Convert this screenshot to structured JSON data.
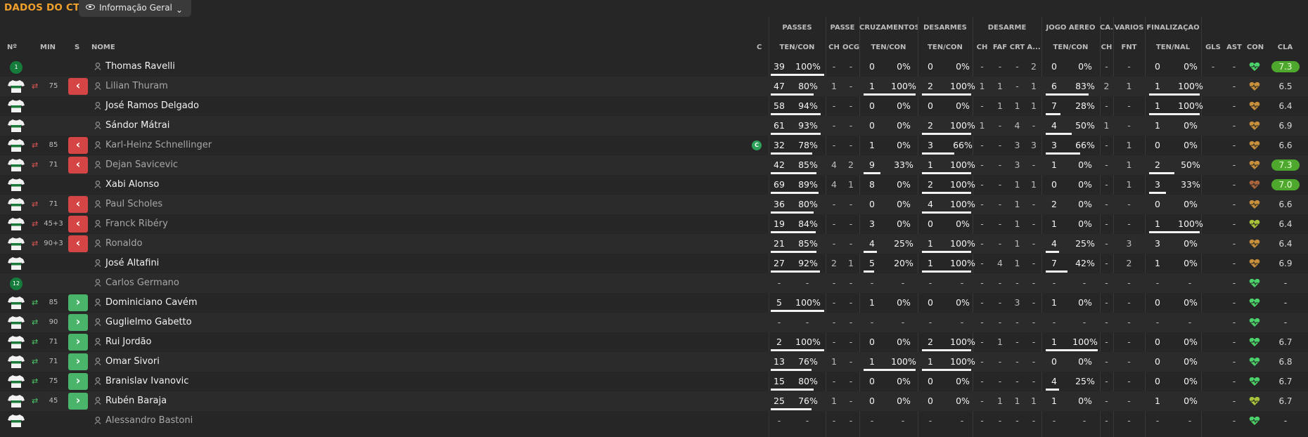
{
  "header": {
    "title": "DADOS DO CTB",
    "view_label": "Informação Geral",
    "view_icon": "eye-icon",
    "dropdown_icon": "chevron-down-icon"
  },
  "column_groups": [
    {
      "key": "passes",
      "label": "PASSES"
    },
    {
      "key": "passe",
      "label": "PASSE"
    },
    {
      "key": "cruzamentos",
      "label": "CRUZAMENTOS"
    },
    {
      "key": "desarmes",
      "label": "DESARMES"
    },
    {
      "key": "desarme",
      "label": "DESARME"
    },
    {
      "key": "jogo_aereo",
      "label": "JOGO AÉREO"
    },
    {
      "key": "ca",
      "label": "CA..."
    },
    {
      "key": "varios",
      "label": "VÁRIOS"
    },
    {
      "key": "finalizacao",
      "label": "FINALIZAÇÃO"
    }
  ],
  "columns": {
    "num": "Nº",
    "min": "MIN",
    "s": "S",
    "nome": "NOME",
    "c": "C",
    "passes": "TEN/CON",
    "passe_ch": "CH",
    "passe_ocg": "OCG",
    "cruz": "TEN/CON",
    "desarmes": "TEN/CON",
    "desarme_ch": "CH",
    "desarme_faf": "FAF",
    "desarme_crt": "CRT",
    "desarme_a": "A...",
    "aereo": "TEN/CON",
    "ca_ch": "CH",
    "varios_fnt": "FNT",
    "final": "TEN/NAL",
    "gls": "GLS",
    "ast": "AST",
    "con": "CON",
    "cla": "CLA"
  },
  "players": [
    {
      "num": "1",
      "kit": "goalkeeper",
      "min": "",
      "sub": "",
      "name": "Thomas Ravelli",
      "active": true,
      "captain": false,
      "passes": [
        "39",
        "100%"
      ],
      "passes_bar": 1,
      "p_ch": "-",
      "p_ocg": "-",
      "cruz": [
        "0",
        "0%"
      ],
      "cruz_bar": 0,
      "des": [
        "0",
        "0%"
      ],
      "des_bar": 0,
      "d_ch": "-",
      "d_faf": "-",
      "d_crt": "-",
      "d_a": "2",
      "aereo": [
        "0",
        "0%"
      ],
      "aereo_bar": 0,
      "ca_ch": "-",
      "fnt": "-",
      "final": [
        "0",
        "0%"
      ],
      "final_bar": 0,
      "gls": "-",
      "ast": "-",
      "con": "#4bd26b",
      "cla": "7.3",
      "cla_hi": true
    },
    {
      "num": "",
      "kit": "outfield",
      "min": "75",
      "sub": "out",
      "name": "Lilian Thuram",
      "active": false,
      "captain": false,
      "passes": [
        "47",
        "80%"
      ],
      "passes_bar": 0.8,
      "p_ch": "1",
      "p_ocg": "-",
      "cruz": [
        "1",
        "100%"
      ],
      "cruz_bar": 1,
      "des": [
        "2",
        "100%"
      ],
      "des_bar": 1,
      "d_ch": "1",
      "d_faf": "1",
      "d_crt": "-",
      "d_a": "1",
      "aereo": [
        "6",
        "83%"
      ],
      "aereo_bar": 0.83,
      "ca_ch": "2",
      "fnt": "1",
      "final": [
        "1",
        "100%"
      ],
      "final_bar": 1,
      "gls": "-",
      "ast": "",
      "con": "#c8903a",
      "cla": "6.5",
      "cla_hi": false
    },
    {
      "num": "",
      "kit": "outfield",
      "min": "",
      "sub": "",
      "name": "José Ramos Delgado",
      "active": true,
      "captain": false,
      "passes": [
        "58",
        "94%"
      ],
      "passes_bar": 0.94,
      "p_ch": "-",
      "p_ocg": "-",
      "cruz": [
        "0",
        "0%"
      ],
      "cruz_bar": 0,
      "des": [
        "0",
        "0%"
      ],
      "des_bar": 0,
      "d_ch": "-",
      "d_faf": "1",
      "d_crt": "1",
      "d_a": "1",
      "aereo": [
        "7",
        "28%"
      ],
      "aereo_bar": 0.28,
      "ca_ch": "-",
      "fnt": "-",
      "final": [
        "1",
        "100%"
      ],
      "final_bar": 1,
      "gls": "-",
      "ast": "",
      "con": "#c8903a",
      "cla": "6.4",
      "cla_hi": false
    },
    {
      "num": "",
      "kit": "outfield",
      "min": "",
      "sub": "",
      "name": "Sándor Mátrai",
      "active": true,
      "captain": false,
      "passes": [
        "61",
        "93%"
      ],
      "passes_bar": 0.93,
      "p_ch": "-",
      "p_ocg": "-",
      "cruz": [
        "0",
        "0%"
      ],
      "cruz_bar": 0,
      "des": [
        "2",
        "100%"
      ],
      "des_bar": 1,
      "d_ch": "1",
      "d_faf": "-",
      "d_crt": "4",
      "d_a": "-",
      "aereo": [
        "4",
        "50%"
      ],
      "aereo_bar": 0.5,
      "ca_ch": "1",
      "fnt": "-",
      "final": [
        "1",
        "0%"
      ],
      "final_bar": 0,
      "gls": "-",
      "ast": "",
      "con": "#c8903a",
      "cla": "6.9",
      "cla_hi": false
    },
    {
      "num": "",
      "kit": "outfield",
      "min": "85",
      "sub": "out",
      "name": "Karl-Heinz Schnellinger",
      "active": false,
      "captain": true,
      "passes": [
        "32",
        "78%"
      ],
      "passes_bar": 0.78,
      "p_ch": "-",
      "p_ocg": "-",
      "cruz": [
        "1",
        "0%"
      ],
      "cruz_bar": 0,
      "des": [
        "3",
        "66%"
      ],
      "des_bar": 0.66,
      "d_ch": "-",
      "d_faf": "-",
      "d_crt": "3",
      "d_a": "3",
      "aereo": [
        "3",
        "66%"
      ],
      "aereo_bar": 0.66,
      "ca_ch": "-",
      "fnt": "1",
      "final": [
        "0",
        "0%"
      ],
      "final_bar": 0,
      "gls": "-",
      "ast": "",
      "con": "#c8903a",
      "cla": "6.6",
      "cla_hi": false
    },
    {
      "num": "",
      "kit": "outfield",
      "min": "71",
      "sub": "out",
      "name": "Dejan Savicevic",
      "active": false,
      "captain": false,
      "passes": [
        "42",
        "85%"
      ],
      "passes_bar": 0.85,
      "p_ch": "4",
      "p_ocg": "2",
      "cruz": [
        "9",
        "33%"
      ],
      "cruz_bar": 0.33,
      "des": [
        "1",
        "100%"
      ],
      "des_bar": 1,
      "d_ch": "-",
      "d_faf": "-",
      "d_crt": "3",
      "d_a": "-",
      "aereo": [
        "1",
        "0%"
      ],
      "aereo_bar": 0,
      "ca_ch": "-",
      "fnt": "1",
      "final": [
        "2",
        "50%"
      ],
      "final_bar": 0.5,
      "gls": "-",
      "ast": "",
      "con": "#c8903a",
      "cla": "7.3",
      "cla_hi": true
    },
    {
      "num": "",
      "kit": "outfield",
      "min": "",
      "sub": "",
      "name": "Xabi Alonso",
      "active": true,
      "captain": false,
      "passes": [
        "69",
        "89%"
      ],
      "passes_bar": 0.89,
      "p_ch": "4",
      "p_ocg": "1",
      "cruz": [
        "8",
        "0%"
      ],
      "cruz_bar": 0,
      "des": [
        "2",
        "100%"
      ],
      "des_bar": 1,
      "d_ch": "-",
      "d_faf": "-",
      "d_crt": "1",
      "d_a": "1",
      "aereo": [
        "0",
        "0%"
      ],
      "aereo_bar": 0,
      "ca_ch": "-",
      "fnt": "1",
      "final": [
        "3",
        "33%"
      ],
      "final_bar": 0.33,
      "gls": "-",
      "ast": "",
      "con": "#a8643a",
      "cla": "7.0",
      "cla_hi": true
    },
    {
      "num": "",
      "kit": "outfield",
      "min": "71",
      "sub": "out",
      "name": "Paul Scholes",
      "active": false,
      "captain": false,
      "passes": [
        "36",
        "80%"
      ],
      "passes_bar": 0.8,
      "p_ch": "-",
      "p_ocg": "-",
      "cruz": [
        "0",
        "0%"
      ],
      "cruz_bar": 0,
      "des": [
        "4",
        "100%"
      ],
      "des_bar": 1,
      "d_ch": "-",
      "d_faf": "-",
      "d_crt": "1",
      "d_a": "-",
      "aereo": [
        "2",
        "0%"
      ],
      "aereo_bar": 0,
      "ca_ch": "-",
      "fnt": "-",
      "final": [
        "0",
        "0%"
      ],
      "final_bar": 0,
      "gls": "-",
      "ast": "",
      "con": "#c8903a",
      "cla": "6.6",
      "cla_hi": false
    },
    {
      "num": "",
      "kit": "outfield",
      "min": "45+3",
      "sub": "out",
      "name": "Franck Ribéry",
      "active": false,
      "captain": false,
      "passes": [
        "19",
        "84%"
      ],
      "passes_bar": 0.84,
      "p_ch": "-",
      "p_ocg": "-",
      "cruz": [
        "3",
        "0%"
      ],
      "cruz_bar": 0,
      "des": [
        "0",
        "0%"
      ],
      "des_bar": 0,
      "d_ch": "-",
      "d_faf": "-",
      "d_crt": "1",
      "d_a": "-",
      "aereo": [
        "1",
        "0%"
      ],
      "aereo_bar": 0,
      "ca_ch": "-",
      "fnt": "-",
      "final": [
        "1",
        "100%"
      ],
      "final_bar": 1,
      "gls": "-",
      "ast": "",
      "con": "#a8c43a",
      "cla": "6.4",
      "cla_hi": false
    },
    {
      "num": "",
      "kit": "outfield",
      "min": "90+3",
      "sub": "out",
      "name": "Ronaldo",
      "active": false,
      "captain": false,
      "passes": [
        "21",
        "85%"
      ],
      "passes_bar": 0.85,
      "p_ch": "-",
      "p_ocg": "-",
      "cruz": [
        "4",
        "25%"
      ],
      "cruz_bar": 0.25,
      "des": [
        "1",
        "100%"
      ],
      "des_bar": 1,
      "d_ch": "-",
      "d_faf": "-",
      "d_crt": "1",
      "d_a": "-",
      "aereo": [
        "4",
        "25%"
      ],
      "aereo_bar": 0.25,
      "ca_ch": "-",
      "fnt": "3",
      "final": [
        "3",
        "0%"
      ],
      "final_bar": 0,
      "gls": "-",
      "ast": "",
      "con": "#c8903a",
      "cla": "6.4",
      "cla_hi": false
    },
    {
      "num": "",
      "kit": "outfield",
      "min": "",
      "sub": "",
      "name": "José Altafini",
      "active": true,
      "captain": false,
      "passes": [
        "27",
        "92%"
      ],
      "passes_bar": 0.92,
      "p_ch": "2",
      "p_ocg": "1",
      "cruz": [
        "5",
        "20%"
      ],
      "cruz_bar": 0.2,
      "des": [
        "1",
        "100%"
      ],
      "des_bar": 1,
      "d_ch": "-",
      "d_faf": "4",
      "d_crt": "1",
      "d_a": "-",
      "aereo": [
        "7",
        "42%"
      ],
      "aereo_bar": 0.42,
      "ca_ch": "-",
      "fnt": "2",
      "final": [
        "1",
        "0%"
      ],
      "final_bar": 0,
      "gls": "-",
      "ast": "",
      "con": "#c8903a",
      "cla": "6.9",
      "cla_hi": false
    },
    {
      "num": "12",
      "kit": "goalkeeper",
      "min": "",
      "sub": "",
      "name": "Carlos  Germano",
      "active": false,
      "captain": false,
      "passes": [
        "-",
        ""
      ],
      "passes_bar": 0,
      "p_ch": "-",
      "p_ocg": "-",
      "cruz": [
        "-",
        ""
      ],
      "cruz_bar": 0,
      "des": [
        "-",
        ""
      ],
      "des_bar": 0,
      "d_ch": "-",
      "d_faf": "-",
      "d_crt": "-",
      "d_a": "-",
      "aereo": [
        "-",
        ""
      ],
      "aereo_bar": 0,
      "ca_ch": "-",
      "fnt": "-",
      "final": [
        "-",
        ""
      ],
      "final_bar": 0,
      "gls": "-",
      "ast": "",
      "con": "#4bd26b",
      "cla": "-",
      "cla_hi": false
    },
    {
      "num": "",
      "kit": "outfield",
      "min": "85",
      "sub": "in",
      "name": "Dominiciano Cavém",
      "active": true,
      "captain": false,
      "passes": [
        "5",
        "100%"
      ],
      "passes_bar": 1,
      "p_ch": "-",
      "p_ocg": "-",
      "cruz": [
        "1",
        "0%"
      ],
      "cruz_bar": 0,
      "des": [
        "0",
        "0%"
      ],
      "des_bar": 0,
      "d_ch": "-",
      "d_faf": "-",
      "d_crt": "3",
      "d_a": "-",
      "aereo": [
        "1",
        "0%"
      ],
      "aereo_bar": 0,
      "ca_ch": "-",
      "fnt": "-",
      "final": [
        "0",
        "0%"
      ],
      "final_bar": 0,
      "gls": "-",
      "ast": "",
      "con": "#4bd26b",
      "cla": "-",
      "cla_hi": false
    },
    {
      "num": "",
      "kit": "outfield",
      "min": "90",
      "sub": "in",
      "name": "Guglielmo Gabetto",
      "active": true,
      "captain": false,
      "passes": [
        "-",
        ""
      ],
      "passes_bar": 0,
      "p_ch": "-",
      "p_ocg": "-",
      "cruz": [
        "-",
        ""
      ],
      "cruz_bar": 0,
      "des": [
        "-",
        ""
      ],
      "des_bar": 0,
      "d_ch": "-",
      "d_faf": "-",
      "d_crt": "-",
      "d_a": "-",
      "aereo": [
        "-",
        ""
      ],
      "aereo_bar": 0,
      "ca_ch": "-",
      "fnt": "-",
      "final": [
        "-",
        ""
      ],
      "final_bar": 0,
      "gls": "-",
      "ast": "",
      "con": "#4bd26b",
      "cla": "-",
      "cla_hi": false
    },
    {
      "num": "",
      "kit": "outfield",
      "min": "71",
      "sub": "in",
      "name": "Rui Jordão",
      "active": true,
      "captain": false,
      "passes": [
        "2",
        "100%"
      ],
      "passes_bar": 1,
      "p_ch": "-",
      "p_ocg": "-",
      "cruz": [
        "0",
        "0%"
      ],
      "cruz_bar": 0,
      "des": [
        "2",
        "100%"
      ],
      "des_bar": 1,
      "d_ch": "-",
      "d_faf": "1",
      "d_crt": "-",
      "d_a": "-",
      "aereo": [
        "1",
        "100%"
      ],
      "aereo_bar": 1,
      "ca_ch": "-",
      "fnt": "-",
      "final": [
        "0",
        "0%"
      ],
      "final_bar": 0,
      "gls": "-",
      "ast": "",
      "con": "#4bd26b",
      "cla": "6.7",
      "cla_hi": false
    },
    {
      "num": "",
      "kit": "outfield",
      "min": "71",
      "sub": "in",
      "name": "Omar Sivori",
      "active": true,
      "captain": false,
      "passes": [
        "13",
        "76%"
      ],
      "passes_bar": 0.76,
      "p_ch": "1",
      "p_ocg": "-",
      "cruz": [
        "1",
        "100%"
      ],
      "cruz_bar": 1,
      "des": [
        "1",
        "100%"
      ],
      "des_bar": 1,
      "d_ch": "-",
      "d_faf": "-",
      "d_crt": "-",
      "d_a": "-",
      "aereo": [
        "0",
        "0%"
      ],
      "aereo_bar": 0,
      "ca_ch": "-",
      "fnt": "-",
      "final": [
        "0",
        "0%"
      ],
      "final_bar": 0,
      "gls": "-",
      "ast": "",
      "con": "#4bd26b",
      "cla": "6.8",
      "cla_hi": false
    },
    {
      "num": "",
      "kit": "outfield",
      "min": "75",
      "sub": "in",
      "name": "Branislav Ivanovic",
      "active": true,
      "captain": false,
      "passes": [
        "15",
        "80%"
      ],
      "passes_bar": 0.8,
      "p_ch": "-",
      "p_ocg": "-",
      "cruz": [
        "0",
        "0%"
      ],
      "cruz_bar": 0,
      "des": [
        "0",
        "0%"
      ],
      "des_bar": 0,
      "d_ch": "-",
      "d_faf": "-",
      "d_crt": "-",
      "d_a": "-",
      "aereo": [
        "4",
        "25%"
      ],
      "aereo_bar": 0.25,
      "ca_ch": "-",
      "fnt": "-",
      "final": [
        "0",
        "0%"
      ],
      "final_bar": 0,
      "gls": "-",
      "ast": "",
      "con": "#4bd26b",
      "cla": "6.7",
      "cla_hi": false
    },
    {
      "num": "",
      "kit": "outfield",
      "min": "45",
      "sub": "in",
      "name": "Rubén Baraja",
      "active": true,
      "captain": false,
      "passes": [
        "25",
        "76%"
      ],
      "passes_bar": 0.76,
      "p_ch": "1",
      "p_ocg": "-",
      "cruz": [
        "0",
        "0%"
      ],
      "cruz_bar": 0,
      "des": [
        "0",
        "0%"
      ],
      "des_bar": 0,
      "d_ch": "-",
      "d_faf": "1",
      "d_crt": "1",
      "d_a": "1",
      "aereo": [
        "1",
        "0%"
      ],
      "aereo_bar": 0,
      "ca_ch": "-",
      "fnt": "-",
      "final": [
        "1",
        "0%"
      ],
      "final_bar": 0,
      "gls": "-",
      "ast": "",
      "con": "#a8c43a",
      "cla": "6.7",
      "cla_hi": false
    },
    {
      "num": "",
      "kit": "outfield",
      "min": "",
      "sub": "",
      "name": "Alessandro Bastoni",
      "active": false,
      "captain": false,
      "passes": [
        "-",
        ""
      ],
      "passes_bar": 0,
      "p_ch": "-",
      "p_ocg": "-",
      "cruz": [
        "-",
        ""
      ],
      "cruz_bar": 0,
      "des": [
        "-",
        ""
      ],
      "des_bar": 0,
      "d_ch": "-",
      "d_faf": "-",
      "d_crt": "-",
      "d_a": "-",
      "aereo": [
        "-",
        ""
      ],
      "aereo_bar": 0,
      "ca_ch": "-",
      "fnt": "-",
      "final": [
        "-",
        ""
      ],
      "final_bar": 0,
      "gls": "-",
      "ast": "",
      "con": "#4bd26b",
      "cla": "-",
      "cla_hi": false
    }
  ],
  "captain_badge": "C",
  "sub_out_glyph": "‹",
  "sub_in_glyph": "›",
  "swap_glyph": "⇄",
  "colors": {
    "accent": "#f0a02c",
    "sub_out": "#d64545",
    "sub_in": "#4ab56a",
    "rating_high": "#4fa82e",
    "kit_badge": "#167c3c"
  }
}
